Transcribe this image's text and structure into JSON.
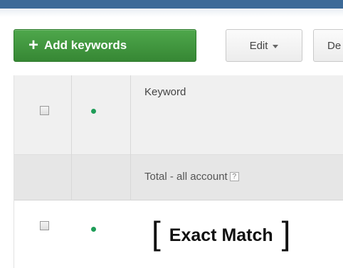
{
  "toolbar": {
    "add_keywords_icon": "+",
    "add_keywords_label": "Add keywords",
    "edit_label": "Edit",
    "cut_button_label": "De"
  },
  "table": {
    "header": {
      "keyword_column_label": "Keyword"
    },
    "total_row": {
      "label": "Total - all account",
      "help_icon": "?"
    },
    "rows": [
      {
        "status": "enabled",
        "keyword_bracket_open": "[",
        "keyword": "Exact Match",
        "keyword_bracket_close": "]"
      }
    ]
  },
  "colors": {
    "top_bar": "#3c6a98",
    "add_button": "#3f9a3d",
    "status_dot": "#1f9d58"
  }
}
